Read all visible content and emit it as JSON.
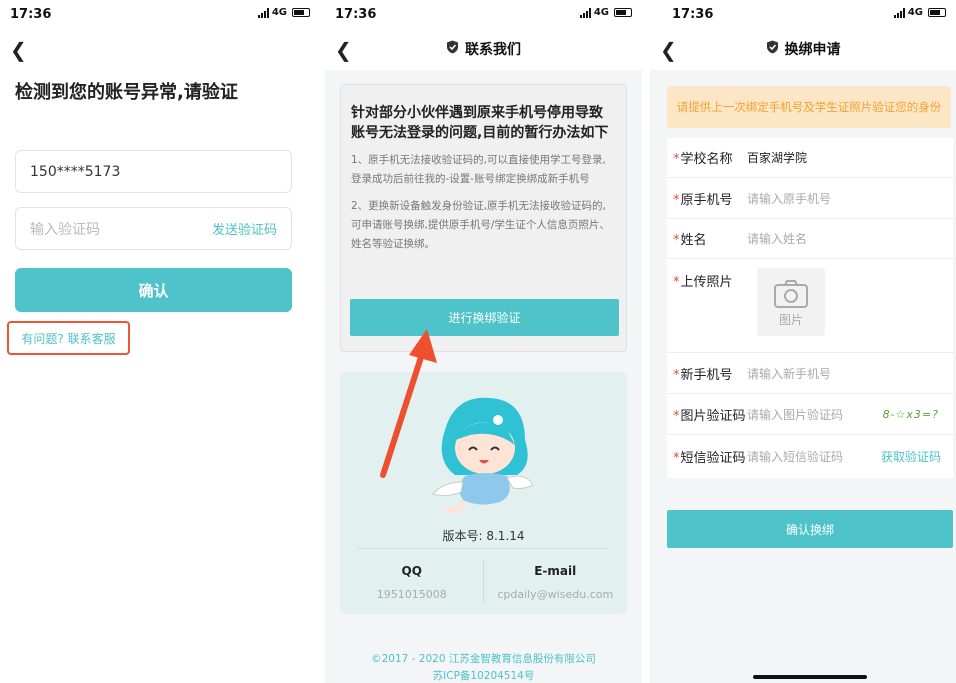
{
  "status": {
    "time_1": "17:36",
    "time_2": "17:36",
    "time_3": "17:36",
    "network": "4G"
  },
  "screen1": {
    "title": "检测到您的账号异常,请验证",
    "phone_value": "150****5173",
    "code_placeholder": "输入验证码",
    "send_code": "发送验证码",
    "confirm": "确认",
    "help_link": "有问题? 联系客服"
  },
  "screen2": {
    "nav_title": "联系我们",
    "card_title": "针对部分小伙伴遇到原来手机号停用导致账号无法登录的问题,目前的暂行办法如下",
    "para1": "1、原手机无法接收验证码的,可以直接使用学工号登录,登录成功后前往我的-设置-账号绑定换绑成新手机号",
    "para2": "2、更换新设备触发身份验证,原手机无法接收验证码的,可申请账号换绑,提供原手机号/学生证个人信息页照片、姓名等验证换绑。",
    "verify_button": "进行换绑验证",
    "version": "版本号: 8.1.14",
    "qq_label": "QQ",
    "qq_value": "1951015008",
    "email_label": "E-mail",
    "email_value": "cpdaily@wisedu.com",
    "footer_line1": "©2017 - 2020 江苏金智教育信息股份有限公司",
    "footer_line2": "苏ICP备10204514号"
  },
  "screen3": {
    "nav_title": "换绑申请",
    "notice": "请提供上一次绑定手机号及学生证照片验证您的身份",
    "star": "*",
    "school_label": "学校名称",
    "school_value": "百家湖学院",
    "old_phone_label": "原手机号",
    "old_phone_placeholder": "请输入原手机号",
    "name_label": "姓名",
    "name_placeholder": "请输入姓名",
    "photo_label": "上传照片",
    "photo_caption": "图片",
    "new_phone_label": "新手机号",
    "new_phone_placeholder": "请输入新手机号",
    "img_code_label": "图片验证码",
    "img_code_placeholder": "请输入图片验证码",
    "captcha_text": "8-☆x3=?",
    "sms_label": "短信验证码",
    "sms_placeholder": "请输入短信验证码",
    "sms_action": "获取验证码",
    "confirm": "确认换绑"
  },
  "colors": {
    "accent": "#4ec3c9",
    "highlight": "#ee5533",
    "notice_bg": "#fde6c5",
    "notice_text": "#f0a331",
    "required": "#e84a3a"
  },
  "icons": {
    "back": "chevron-left-icon",
    "shield": "shield-check-icon",
    "camera": "camera-icon",
    "arrow": "red-arrow-icon"
  }
}
